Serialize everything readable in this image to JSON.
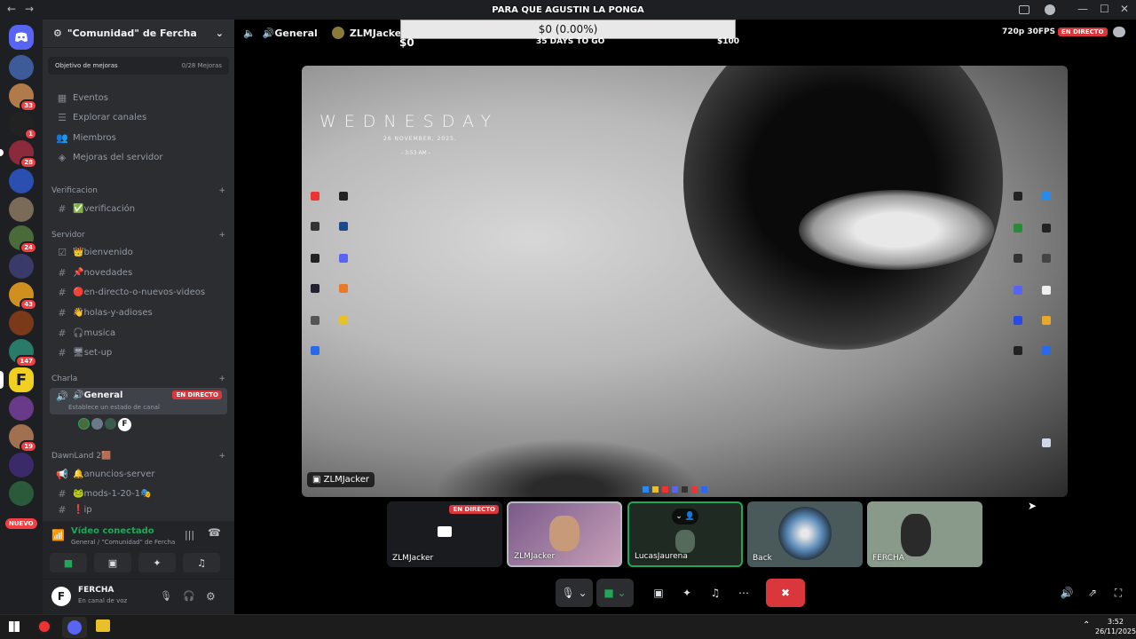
{
  "topbar": {
    "back": "←",
    "forward": "→",
    "inbox_icon": "inbox-icon",
    "help_icon": "help-icon",
    "min": "—",
    "max": "☐",
    "close": "✕"
  },
  "servers": {
    "badges": [
      "33",
      "1",
      "28",
      "24",
      "43",
      "147",
      "19"
    ],
    "new_label": "NUEVO"
  },
  "server": {
    "name": "\"Comunidad\" de Fercha",
    "boost_label": "Objetivo de mejoras",
    "boost_count": "0/28 Mejoras",
    "menu": [
      "Eventos",
      "Explorar canales",
      "Miembros",
      "Mejoras del servidor"
    ],
    "categories": {
      "verificacion": "Verificacion",
      "servidor": "Servidor",
      "charla": "Charla",
      "dawnland": "DawnLand 2🟫"
    },
    "channels": {
      "verificacion": "✅verificación",
      "bienvenido": "👑bienvenido",
      "novedades": "📌novedades",
      "directo": "🔴en-directo-o-nuevos-videos",
      "holas": "👋holas-y-adioses",
      "musica": "🎧musica",
      "setup": "🖥set-up",
      "general": "🔊General",
      "general_live": "EN DIRECTO",
      "general_status": "Establece un estado de canal",
      "anuncios": "🔔anuncios-server",
      "mods": "🐸mods-1-20-1🎭",
      "ip": "❗ip"
    }
  },
  "voice": {
    "status": "Vídeo conectado",
    "location": "General / \"Comunidad\" de Fercha"
  },
  "user": {
    "name": "FERCHA",
    "status": "En canal de voz",
    "avatar": "F"
  },
  "header": {
    "channel": "🔊General",
    "title": "ZLMJacker jug",
    "quality": "720p 30FPS",
    "live": "EN DIRECTO"
  },
  "goal": {
    "title": "PARA QUE AGUSTIN LA PONGA",
    "progress_text": "$0 (0.00%)",
    "left": "$0",
    "days": "35 DAYS TO GO",
    "right": "$100",
    "progress": 0.0
  },
  "stream": {
    "weekday": "WEDNESDAY",
    "date": "26 NOVEMBER, 2025.",
    "time": "- 3:53 AM -",
    "owner": "ZLMJacker"
  },
  "tiles": {
    "t1": {
      "name": "ZLMJacker",
      "live": "EN DIRECTO"
    },
    "t2": {
      "name": "ZLMJacker"
    },
    "t3": {
      "name": "LucasJaurena"
    },
    "t4": {
      "name": "Back"
    },
    "t5": {
      "name": "FERCHA"
    }
  },
  "taskbar": {
    "time": "3:52",
    "date": "26/11/2025"
  },
  "colors": {
    "accent": "#5865f2",
    "live": "#da373c",
    "green": "#23a55a"
  }
}
